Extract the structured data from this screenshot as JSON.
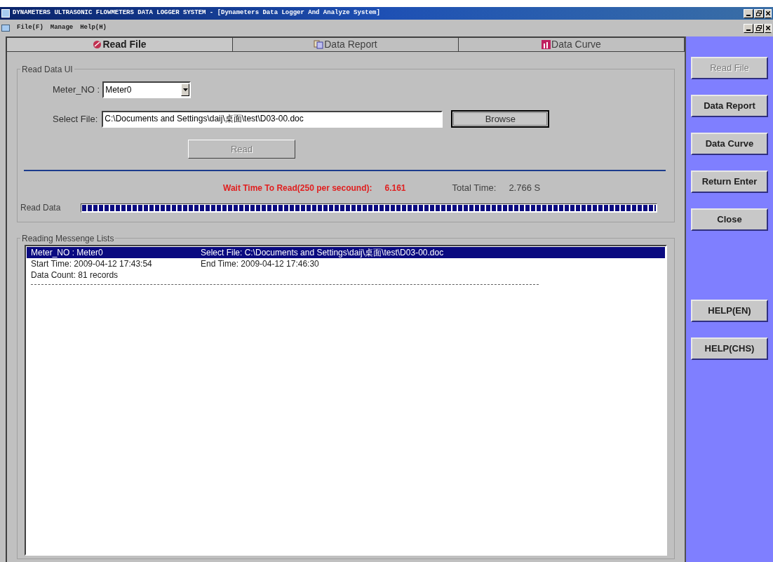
{
  "window": {
    "title": "DYNAMETERS ULTRASONIC FLOWMETERS DATA LOGGER SYSTEM - [Dynameters Data Logger And Analyze System]"
  },
  "menu": [
    "File(F)",
    "Manage",
    "Help(H)"
  ],
  "tabs": [
    {
      "label": "Read File",
      "selected": true
    },
    {
      "label": "Data Report",
      "selected": false
    },
    {
      "label": "Data Curve",
      "selected": false
    }
  ],
  "read_group": {
    "title": "Read Data UI",
    "meter_label": "Meter_NO :",
    "meter_value": "Meter0",
    "file_label": "Select File:",
    "file_value": "C:\\Documents and Settings\\daij\\桌面\\test\\D03-00.doc",
    "browse": "Browse",
    "read": {
      "label": "Read",
      "disabled": true
    },
    "wait_label": "Wait Time To Read(250 per secound):",
    "wait_value": "6.161",
    "total_label": "Total Time:",
    "total_value": "2.766 S",
    "progress_label": "Read Data",
    "progress": {
      "level": 1
    }
  },
  "messages": {
    "title": "Reading Messenge Lists",
    "rows": [
      {
        "selected": true,
        "texts": [
          "Meter_NO : Meter0",
          "Select File: C:\\Documents and Settings\\daij\\桌面\\test\\D03-00.doc"
        ]
      },
      {
        "selected": false,
        "texts": [
          "Start Time: 2009-04-12 17:43:54",
          "End Time: 2009-04-12 17:46:30"
        ]
      },
      {
        "selected": false,
        "texts": [
          "Data Count: 81 records"
        ]
      }
    ]
  },
  "side_buttons": [
    {
      "label": "Read File",
      "disabled": true
    },
    {
      "label": "Data Report",
      "disabled": false
    },
    {
      "label": "Data Curve",
      "disabled": false
    },
    {
      "label": "Return Enter",
      "disabled": false
    },
    {
      "label": "Close",
      "disabled": false
    }
  ],
  "help_buttons": [
    "HELP(EN)",
    "HELP(CHS)"
  ]
}
